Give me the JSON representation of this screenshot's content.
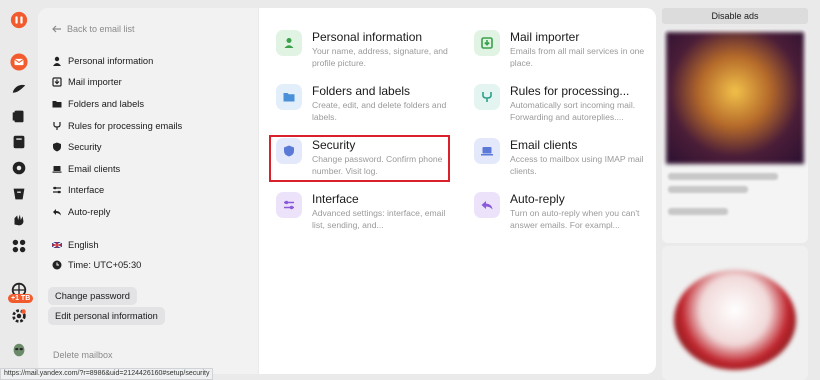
{
  "rail": {
    "icons": [
      "yandex-logo-icon",
      "mail-icon",
      "disk-icon",
      "documents-icon",
      "notes-icon",
      "messenger-icon",
      "translate-icon",
      "telemost-icon",
      "services-icon"
    ],
    "storage_badge": "+1 TB",
    "bottom_icons": [
      "globe-icon",
      "settings-icon",
      "alien-icon"
    ]
  },
  "sidebar": {
    "back": "Back to email list",
    "items": [
      {
        "label": "Personal information",
        "icon": "person-icon"
      },
      {
        "label": "Mail importer",
        "icon": "import-icon"
      },
      {
        "label": "Folders and labels",
        "icon": "folder-icon"
      },
      {
        "label": "Rules for processing emails",
        "icon": "rules-icon"
      },
      {
        "label": "Security",
        "icon": "shield-icon"
      },
      {
        "label": "Email clients",
        "icon": "laptop-icon"
      },
      {
        "label": "Interface",
        "icon": "sliders-icon"
      },
      {
        "label": "Auto-reply",
        "icon": "reply-icon"
      }
    ],
    "language": "English",
    "time": "Time: UTC+05:30",
    "change_password": "Change password",
    "edit_personal": "Edit personal information",
    "delete_mailbox": "Delete mailbox"
  },
  "cards": [
    {
      "title": "Personal information",
      "desc": "Your name, address, signature, and profile picture.",
      "icon": "person-icon",
      "color": "#e1f3e3"
    },
    {
      "title": "Mail importer",
      "desc": "Emails from all mail services in one place.",
      "icon": "import-icon",
      "color": "#e1f3e3"
    },
    {
      "title": "Folders and labels",
      "desc": "Create, edit, and delete folders and labels.",
      "icon": "folder-icon",
      "color": "#e3eefb"
    },
    {
      "title": "Rules for processing...",
      "desc": "Automatically sort incoming mail. Forwarding and autoreplies....",
      "icon": "rules-icon",
      "color": "#e3f4f1"
    },
    {
      "title": "Security",
      "desc": "Change password. Confirm phone number. Visit log.",
      "icon": "shield-icon",
      "color": "#e3e8fb"
    },
    {
      "title": "Email clients",
      "desc": "Access to mailbox using IMAP mail clients.",
      "icon": "laptop-icon",
      "color": "#e3e8fb"
    },
    {
      "title": "Interface",
      "desc": "Advanced settings: interface, email list, sending, and...",
      "icon": "sliders-icon",
      "color": "#ece3fb"
    },
    {
      "title": "Auto-reply",
      "desc": "Turn on auto-reply when you can't answer emails. For exampl...",
      "icon": "reply-icon",
      "color": "#ece3fb"
    }
  ],
  "ads": {
    "disable": "Disable ads"
  },
  "status_url": "https://mail.yandex.com/?r=8986&uid=2124426160#setup/security"
}
